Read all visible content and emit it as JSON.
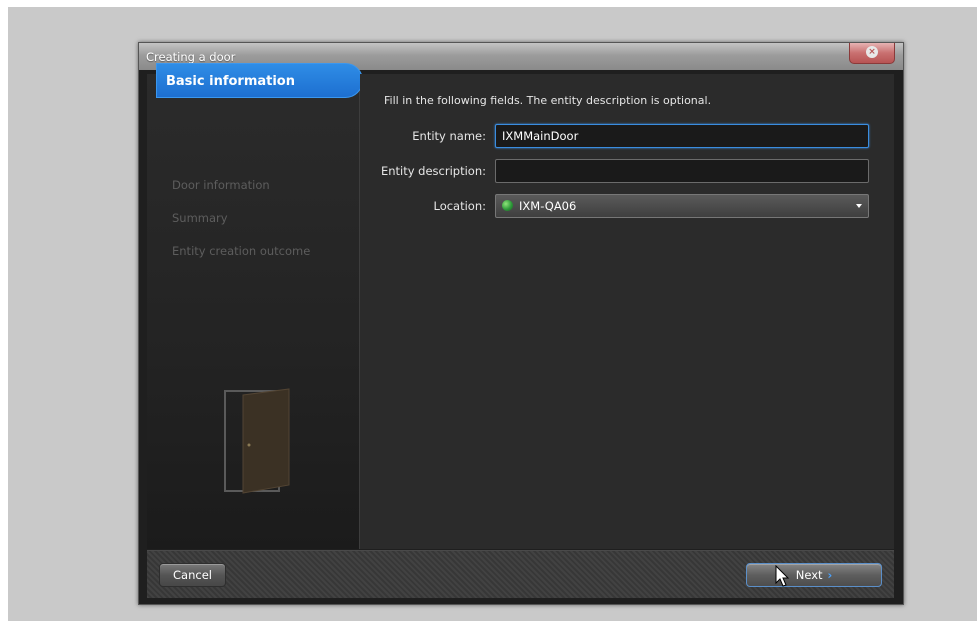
{
  "dialog": {
    "title": "Creating a door",
    "close_glyph": "×"
  },
  "steps": [
    {
      "label": "Basic information",
      "active": true
    },
    {
      "label": "Door information",
      "active": false
    },
    {
      "label": "Summary",
      "active": false
    },
    {
      "label": "Entity creation outcome",
      "active": false
    }
  ],
  "form": {
    "instruction": "Fill in the following fields. The entity description is optional.",
    "entity_name_label": "Entity name:",
    "entity_name_value": "IXMMainDoor",
    "entity_description_label": "Entity description:",
    "entity_description_value": "",
    "location_label": "Location:",
    "location_value": "IXM-QA06",
    "location_icon": "globe-icon"
  },
  "footer": {
    "cancel_label": "Cancel",
    "next_label": "Next",
    "next_icon": "chevron-right-icon"
  },
  "colors": {
    "accent": "#1d6fd0",
    "dialog_bg": "#2b2b2b"
  }
}
